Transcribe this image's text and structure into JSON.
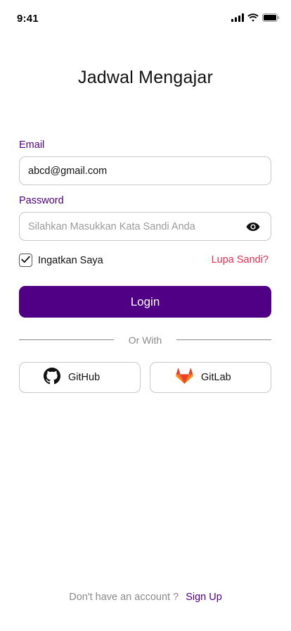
{
  "status_bar": {
    "time": "9:41"
  },
  "app": {
    "title": "Jadwal Mengajar"
  },
  "form": {
    "email": {
      "label": "Email",
      "value": "abcd@gmail.com"
    },
    "password": {
      "label": "Password",
      "placeholder": "Silahkan Masukkan Kata Sandi Anda",
      "value": ""
    },
    "remember": {
      "label": "Ingatkan Saya",
      "checked": true
    },
    "forgot_label": "Lupa Sandi?",
    "login_label": "Login"
  },
  "divider": {
    "text": "Or With"
  },
  "social": {
    "github_label": "GitHub",
    "gitlab_label": "GitLab"
  },
  "footer": {
    "prompt": "Don't have an account ?",
    "signup_label": "Sign Up"
  },
  "colors": {
    "primary": "#4f0084",
    "danger": "#ee2e4f",
    "muted": "#8a8a8a",
    "border": "#c8c8c8"
  },
  "icons": {
    "signal": "cellular-signal-icon",
    "wifi": "wifi-icon",
    "battery": "battery-icon",
    "eye": "eye-icon",
    "check": "checkmark-icon",
    "github": "github-icon",
    "gitlab": "gitlab-icon"
  }
}
